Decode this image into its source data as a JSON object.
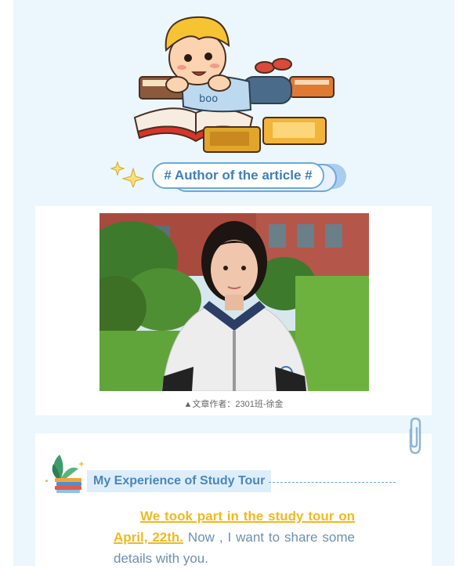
{
  "header": {
    "author_heading": "# Author of the article #"
  },
  "photo": {
    "caption": "▲文章作者：2301班-徐金"
  },
  "article": {
    "section_title": "My Experience of Study Tour",
    "highlight": "We took part in the study tour on April, 22th.",
    "rest": " Now , I want to share some details with you."
  },
  "colors": {
    "page_bg": "#ecf6fd",
    "accent_blue": "#3f7fb8",
    "highlight_yellow": "#f2b81e",
    "text_blue": "#6c90b4"
  },
  "icons": [
    "boy-reading-illustration",
    "sparkle-icon",
    "paperclip-icon",
    "books-plant-icon"
  ]
}
